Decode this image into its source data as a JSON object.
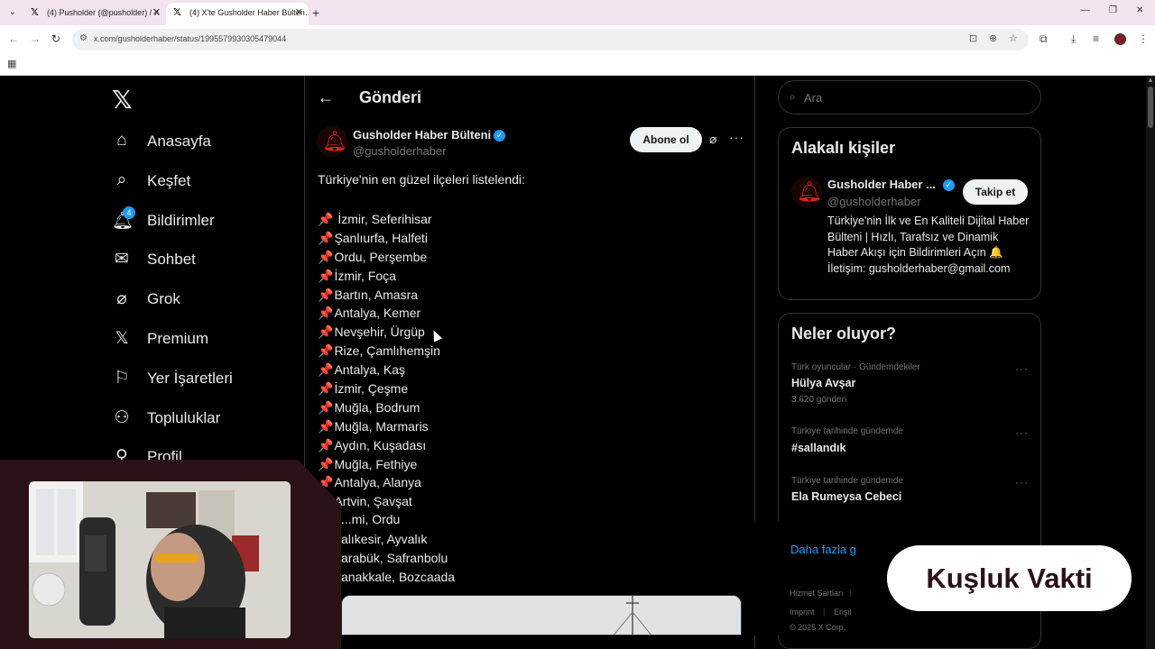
{
  "browser": {
    "tabs": [
      {
        "title": "(4) Pusholder (@pusholder) / X",
        "active": false
      },
      {
        "title": "(4) X'te Gusholder Haber Bülten…",
        "active": true
      }
    ],
    "url": "x.com/gusholderhaber/status/1995579930305479044"
  },
  "sidebar": {
    "items": [
      {
        "label": "Anasayfa",
        "icon": "home-icon"
      },
      {
        "label": "Keşfet",
        "icon": "search-icon"
      },
      {
        "label": "Bildirimler",
        "icon": "bell-icon"
      },
      {
        "label": "Sohbet",
        "icon": "mail-icon"
      },
      {
        "label": "Grok",
        "icon": "grok-icon"
      },
      {
        "label": "Premium",
        "icon": "x-icon"
      },
      {
        "label": "Yer İşaretleri",
        "icon": "bookmark-icon"
      },
      {
        "label": "Topluluklar",
        "icon": "people-icon"
      },
      {
        "label": "Profil",
        "icon": "person-icon"
      }
    ],
    "notification_count": "4"
  },
  "header": {
    "title": "Gönderi"
  },
  "post": {
    "author_name": "Gusholder Haber Bülteni",
    "author_handle": "@gusholderhaber",
    "subscribe_label": "Abone ol",
    "intro": "Türkiye'nin en güzel ilçeleri listelendi:",
    "pin": "📌",
    "items": [
      " İzmir, Seferihisar",
      "Şanlıurfa, Halfeti",
      "Ordu, Perşembe",
      "İzmir, Foça",
      "Bartın, Amasra",
      "Antalya, Kemer",
      "Nevşehir, Ürgüp",
      "Rize, Çamlıhemşin",
      "Antalya, Kaş",
      "İzmir, Çeşme",
      "Muğla, Bodrum",
      "Muğla, Marmaris",
      "Aydın, Kuşadası",
      "Muğla, Fethiye",
      "Antalya, Alanya",
      "Artvin, Şavşat"
    ],
    "continued_items": [
      "...mi, Ordu",
      "alıkesir, Ayvalık",
      "arabük, Safranbolu",
      "anakkale, Bozcaada"
    ]
  },
  "search": {
    "placeholder": "Ara"
  },
  "related": {
    "title": "Alakalı kişiler",
    "name": "Gusholder Haber ...",
    "handle": "@gusholderhaber",
    "follow_label": "Takip et",
    "bio": "Türkiye'nin İlk ve En Kaliteli Dijital Haber Bülteni | Hızlı, Tarafsız ve Dinamik Haber Akışı için Bildirimleri Açın 🔔 İletişim: gusholderhaber@gmail.com"
  },
  "trends": {
    "title": "Neler oluyor?",
    "items": [
      {
        "meta": "Türk oyuncular · Gündemdekiler",
        "name": "Hülya Avşar",
        "count": "3.620 gönderi"
      },
      {
        "meta": "Türkiye tarihinde gündemde",
        "name": "#sallandık",
        "count": ""
      },
      {
        "meta": "Türkiye tarihinde gündemde",
        "name": "Ela Rumeysa Cebeci",
        "count": ""
      }
    ],
    "show_more": "Daha fazla g"
  },
  "footer": {
    "terms": "Hizmet Şartları",
    "imprint": "Imprint",
    "access": "Erişil",
    "copyright": "© 2025 X Corp."
  },
  "overlay": {
    "badge": "Kuşluk Vakti"
  },
  "colors": {
    "accent": "#1d9bf0",
    "background": "#000000",
    "overlay": "#2a1216"
  }
}
